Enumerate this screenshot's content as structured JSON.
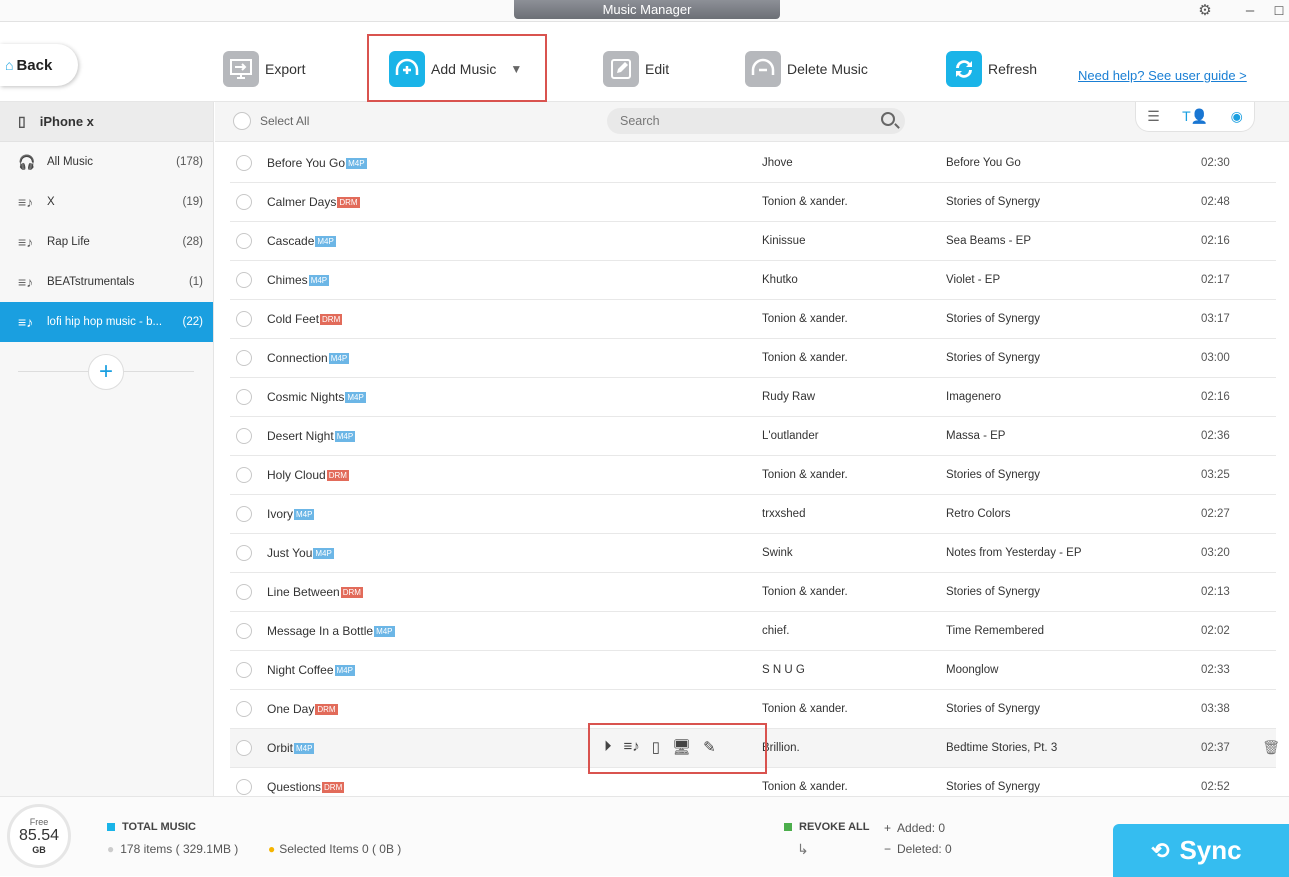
{
  "window": {
    "title": "Music Manager"
  },
  "toolbar": {
    "back_label": "Back",
    "export_label": "Export",
    "add_music_label": "Add Music",
    "edit_label": "Edit",
    "delete_label": "Delete Music",
    "refresh_label": "Refresh",
    "help_link": "Need help? See user guide >"
  },
  "sidebar": {
    "device": "iPhone x",
    "items": [
      {
        "label": "All Music",
        "count": "(178)",
        "icon": "headphones-icon"
      },
      {
        "label": "X",
        "count": "(19)",
        "icon": "playlist-icon"
      },
      {
        "label": "Rap Life",
        "count": "(28)",
        "icon": "playlist-icon"
      },
      {
        "label": "BEATstrumentals",
        "count": "(1)",
        "icon": "playlist-icon"
      },
      {
        "label": "lofi hip hop music - b...",
        "count": "(22)",
        "icon": "playlist-icon"
      }
    ]
  },
  "list_header": {
    "select_all": "Select All",
    "search_placeholder": "Search"
  },
  "songs": [
    {
      "title": "Before You Go",
      "badge": "M4P",
      "artist": "Jhove",
      "album": "Before You Go",
      "duration": "02:30"
    },
    {
      "title": "Calmer Days",
      "badge": "DRM",
      "artist": "Tonion & xander.",
      "album": "Stories of Synergy",
      "duration": "02:48"
    },
    {
      "title": "Cascade",
      "badge": "M4P",
      "artist": "Kinissue",
      "album": "Sea Beams - EP",
      "duration": "02:16"
    },
    {
      "title": "Chimes",
      "badge": "M4P",
      "artist": "Khutko",
      "album": "Violet - EP",
      "duration": "02:17"
    },
    {
      "title": "Cold Feet",
      "badge": "DRM",
      "artist": "Tonion & xander.",
      "album": "Stories of Synergy",
      "duration": "03:17"
    },
    {
      "title": "Connection",
      "badge": "M4P",
      "artist": "Tonion & xander.",
      "album": "Stories of Synergy",
      "duration": "03:00"
    },
    {
      "title": "Cosmic Nights",
      "badge": "M4P",
      "artist": "Rudy Raw",
      "album": "Imagenero",
      "duration": "02:16"
    },
    {
      "title": "Desert Night",
      "badge": "M4P",
      "artist": "L'outlander",
      "album": "Massa - EP",
      "duration": "02:36"
    },
    {
      "title": "Holy Cloud",
      "badge": "DRM",
      "artist": "Tonion & xander.",
      "album": "Stories of Synergy",
      "duration": "03:25"
    },
    {
      "title": "Ivory",
      "badge": "M4P",
      "artist": "trxxshed",
      "album": "Retro Colors",
      "duration": "02:27"
    },
    {
      "title": "Just You",
      "badge": "M4P",
      "artist": "Swink",
      "album": "Notes from Yesterday - EP",
      "duration": "03:20"
    },
    {
      "title": "Line Between",
      "badge": "DRM",
      "artist": "Tonion & xander.",
      "album": "Stories of Synergy",
      "duration": "02:13"
    },
    {
      "title": "Message In a Bottle",
      "badge": "M4P",
      "artist": "chief.",
      "album": "Time Remembered",
      "duration": "02:02"
    },
    {
      "title": "Night Coffee",
      "badge": "M4P",
      "artist": "S N U G",
      "album": "Moonglow",
      "duration": "02:33"
    },
    {
      "title": "One Day",
      "badge": "DRM",
      "artist": "Tonion & xander.",
      "album": "Stories of Synergy",
      "duration": "03:38"
    },
    {
      "title": "Orbit",
      "badge": "M4P",
      "artist": "Brillion.",
      "album": "Bedtime Stories, Pt. 3",
      "duration": "02:37"
    },
    {
      "title": "Questions",
      "badge": "DRM",
      "artist": "Tonion & xander.",
      "album": "Stories of Synergy",
      "duration": "02:52"
    }
  ],
  "footer": {
    "free_label": "Free",
    "free_value": "85.54",
    "free_unit": "GB",
    "total_label": "TOTAL MUSIC",
    "items_info": "178 items ( 329.1MB )",
    "selected_info": "Selected Items 0 ( 0B )",
    "revoke_label": "REVOKE ALL",
    "added": "Added: 0",
    "deleted": "Deleted: 0",
    "sync_label": "Sync"
  },
  "colors": {
    "accent": "#1a9fe0",
    "m4p": "#6cb6e6",
    "drm": "#e26b5a",
    "highlight": "#d9534f"
  }
}
